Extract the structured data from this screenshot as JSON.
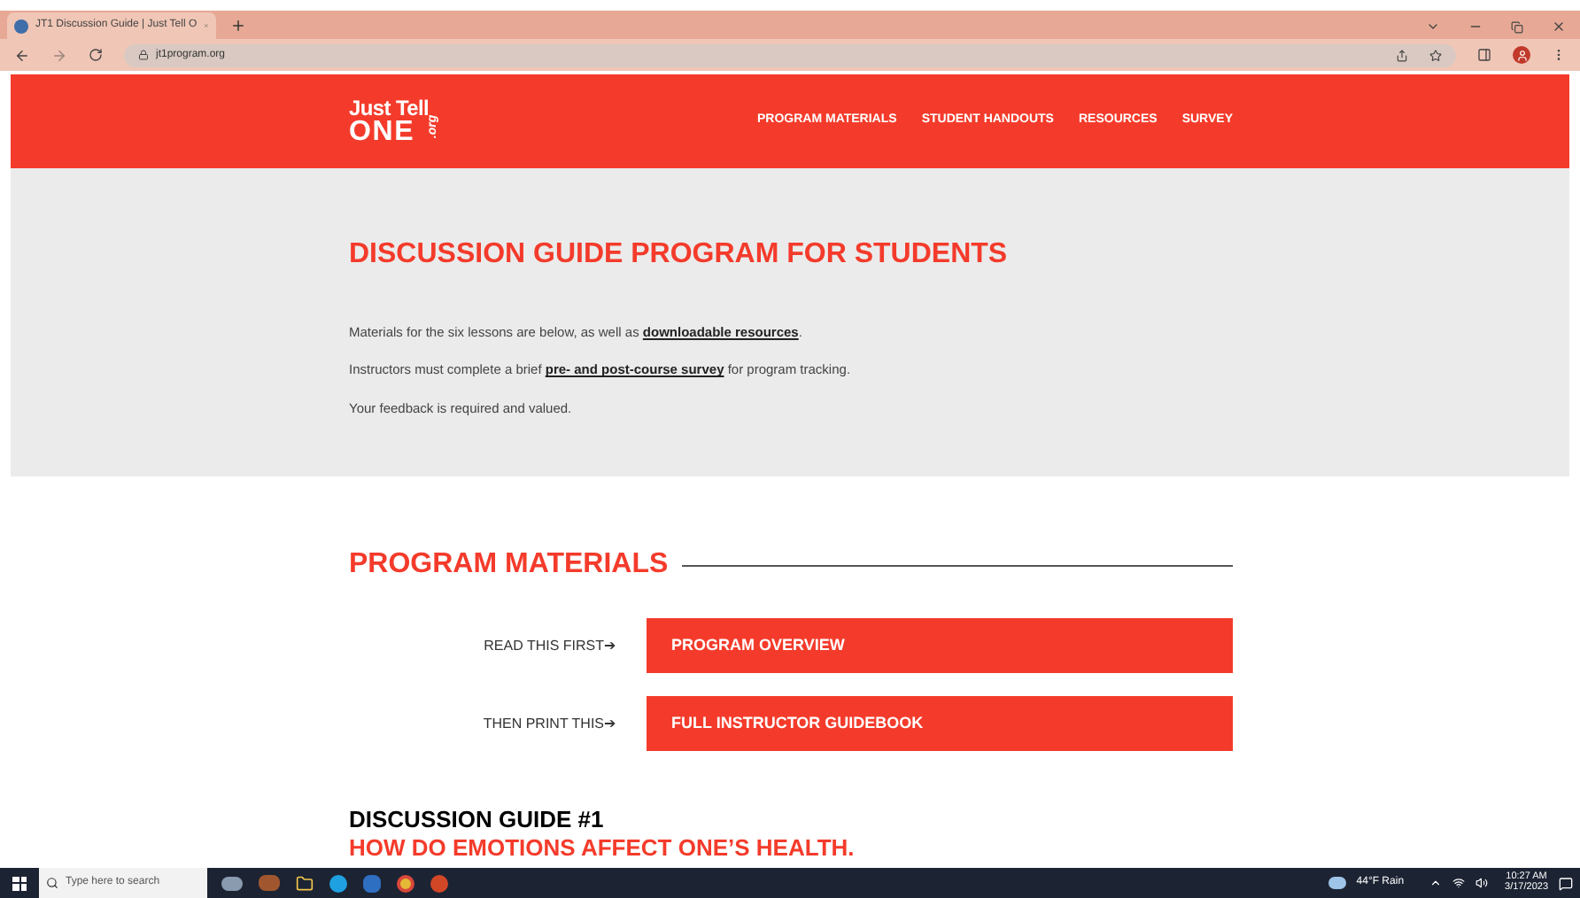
{
  "browser": {
    "tab_title": "JT1 Discussion Guide | Just Tell O",
    "url": "jt1program.org"
  },
  "header": {
    "logo": {
      "line_1": "Just Tell",
      "line_2": "ONE",
      "suffix": ".org"
    },
    "nav": [
      "PROGRAM MATERIALS",
      "STUDENT HANDOUTS",
      "RESOURCES",
      "SURVEY"
    ]
  },
  "intro": {
    "title": "DISCUSSION GUIDE PROGRAM FOR STUDENTS",
    "paragraphs": [
      {
        "before": "Materials for the six lessons are below, as well as ",
        "link": "downloadable resources",
        "after": "."
      },
      {
        "before": "Instructors must complete a brief ",
        "link": "pre- and post-course survey",
        "after": " for program tracking."
      },
      {
        "before": "Your feedback is required and valued."
      }
    ]
  },
  "materials": {
    "title": "PROGRAM MATERIALS",
    "rows": [
      {
        "label": "READ THIS FIRST",
        "arrow": "➔",
        "button": "PROGRAM OVERVIEW"
      },
      {
        "label": "THEN PRINT THIS",
        "arrow": "➔",
        "button": "FULL INSTRUCTOR GUIDEBOOK"
      }
    ]
  },
  "guide": {
    "title": "DISCUSSION GUIDE #1",
    "subtitle": "HOW DO EMOTIONS AFFECT ONE’S HEALTH."
  },
  "taskbar": {
    "search_placeholder": "Type here to search",
    "weather": "44°F  Rain",
    "time": "10:27 AM",
    "date": "3/17/2023"
  }
}
